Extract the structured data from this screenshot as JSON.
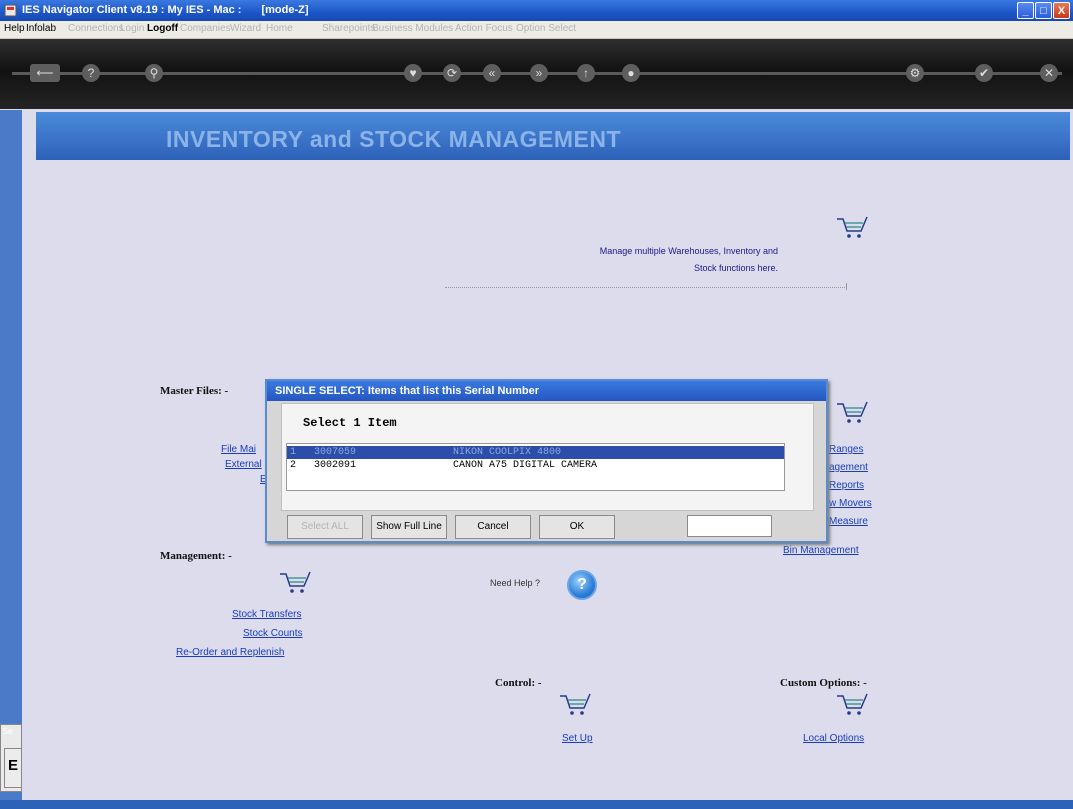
{
  "window": {
    "title": "IES Navigator Client v8.19 : My IES - Mac :",
    "mode": "[mode-Z]",
    "min_label": "_",
    "max_label": "□",
    "close_label": "X"
  },
  "menu": {
    "items": [
      "Help",
      "Infolab",
      "Connections",
      "Login",
      "Logoff",
      "Companies",
      "Wizard",
      "Home",
      "Sharepoints",
      "Business Modules",
      "Action Focus",
      "Option Select"
    ]
  },
  "toolbar": {
    "icons": [
      "back-icon",
      "help-icon",
      "search-icon",
      "heart-icon",
      "refresh-icon",
      "rewind-icon",
      "forward-icon",
      "up-icon",
      "ie-icon",
      "settings-icon",
      "check-icon",
      "close-icon"
    ],
    "glyphs": [
      "⟵",
      "?",
      "⚲",
      "♥",
      "⟳",
      "«",
      "»",
      "↑",
      "●",
      "⚙",
      "✔",
      "✕"
    ]
  },
  "header": {
    "title": "INVENTORY and STOCK MANAGEMENT"
  },
  "intro": {
    "line1": "Manage multiple Warehouses, Inventory and",
    "line2": "Stock functions here."
  },
  "master_files": {
    "label": "Master Files: -",
    "links": [
      "File Mai",
      "External",
      "E"
    ]
  },
  "right_links": [
    "Ranges",
    "agement",
    "Reports",
    "w Movers",
    "Measure",
    "Bin Management"
  ],
  "management": {
    "label": "Management: -",
    "links": [
      "Stock Transfers",
      "Stock Counts",
      "Re-Order and Replenish"
    ]
  },
  "help": {
    "label": "Need Help ?",
    "icon": "?"
  },
  "control": {
    "label": "Control: -",
    "link": "Set Up"
  },
  "custom": {
    "label": "Custom Options: -",
    "link": "Local Options"
  },
  "sidebar": {
    "tab_label": "Se",
    "tab_char": "E"
  },
  "dialog": {
    "title": "SINGLE SELECT: Items that list this Serial Number",
    "heading": "Select 1 Item",
    "rows": [
      {
        "num": "1",
        "code": "3007059",
        "desc": "NIKON COOLPIX 4800",
        "selected": true
      },
      {
        "num": "2",
        "code": "3002091",
        "desc": "CANON A75 DIGITAL CAMERA",
        "selected": false
      }
    ],
    "buttons": {
      "select_all": "Select ALL",
      "show_full_line": "Show Full Line",
      "cancel": "Cancel",
      "ok": "OK"
    },
    "input_value": ""
  }
}
